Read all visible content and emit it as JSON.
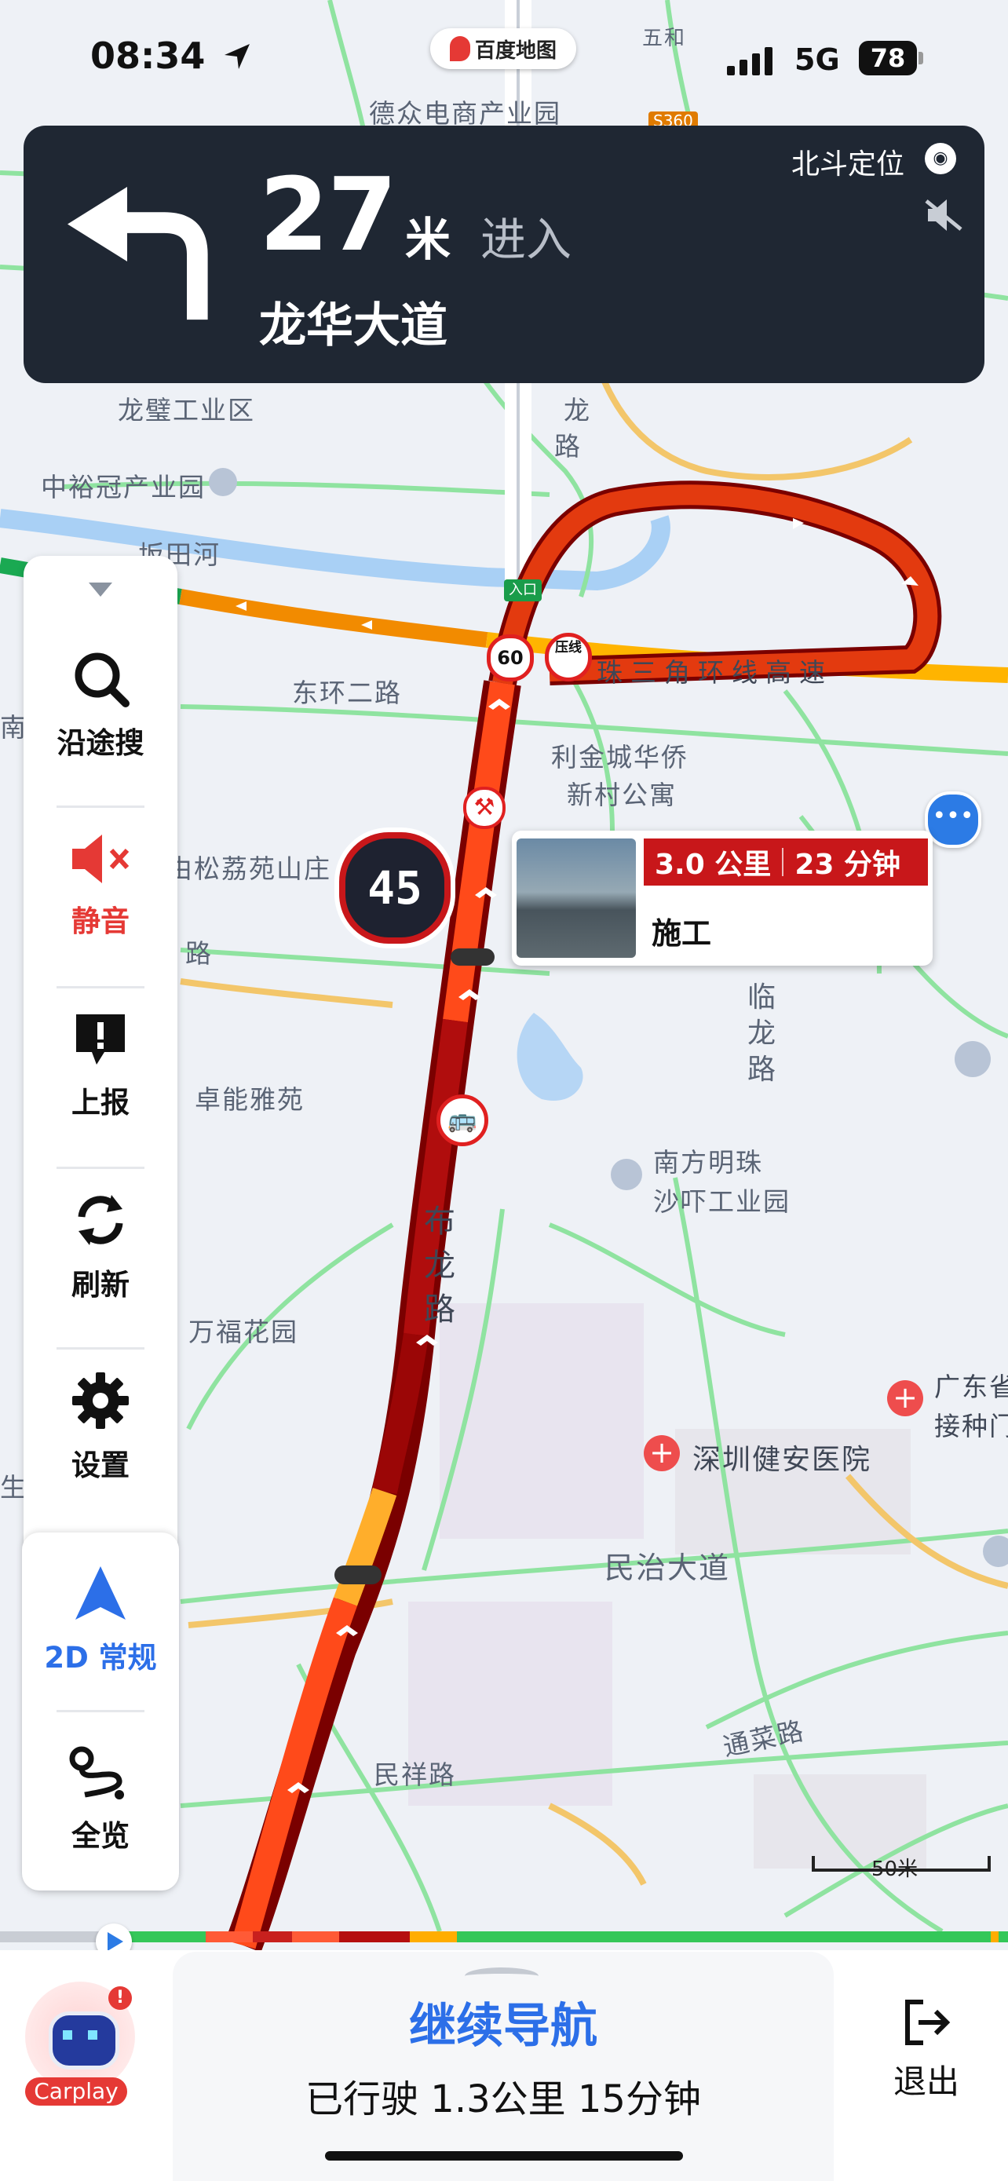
{
  "status": {
    "time": "08:34",
    "app_name": "百度地图",
    "network": "5G",
    "battery": "78"
  },
  "nav": {
    "distance": "27",
    "unit": "米",
    "action": "进入",
    "road": "龙华大道",
    "positioning": "北斗定位"
  },
  "sidebar": {
    "items": [
      {
        "label": "沿途搜",
        "icon": "search-icon"
      },
      {
        "label": "静音",
        "icon": "mute-icon"
      },
      {
        "label": "上报",
        "icon": "report-icon"
      },
      {
        "label": "刷新",
        "icon": "refresh-icon"
      },
      {
        "label": "设置",
        "icon": "gear-icon"
      },
      {
        "label": "2D 常规",
        "icon": "navigation-arrow-icon"
      },
      {
        "label": "全览",
        "icon": "route-overview-icon"
      }
    ]
  },
  "map": {
    "labels": {
      "dezhong": "德众电商产业园",
      "wuhe": "五和",
      "longbi": "龙璧工业区",
      "zhongyu": "中裕冠产业园",
      "bantian": "坂田河",
      "dhuan": "东环二路",
      "lijincheng": "利金城华侨",
      "xincun": "新村公寓",
      "songlizhi": "由松荔苑山庄",
      "zhuoneng": "卓能雅苑",
      "nanfang": "南方明珠",
      "shawei": "沙吓工业园",
      "wanfu": "万福花园",
      "jianan": "深圳健安医院",
      "guangdong1": "广东省",
      "guangdong2": "接种门",
      "minzhi": "民治大道",
      "tongcai": "通菜路",
      "minxiang": "民祥路",
      "longhua": "龙",
      "longhua2": "路",
      "bulong": "布龙路",
      "linlong": "临龙路",
      "zhusanjiao": "珠三角环线高速",
      "lu": "路",
      "nan": "南",
      "sheng": "生",
      "entrance": "入口",
      "speed_limit": "60",
      "yaxian": "压线",
      "s360": "S360",
      "scale": "50米"
    },
    "current_speed": "45",
    "incident": {
      "distance": "3.0 公里",
      "time": "23 分钟",
      "type": "施工"
    }
  },
  "bottom": {
    "continue": "继续导航",
    "progress": "已行驶 1.3公里 15分钟",
    "exit": "退出",
    "carplay": "Carplay"
  },
  "colors": {
    "nav_bg": "#1f2733",
    "route_red": "#d21a08",
    "route_dark": "#a50d0d",
    "accent_blue": "#2c6fe8",
    "mute_red": "#e53935"
  }
}
